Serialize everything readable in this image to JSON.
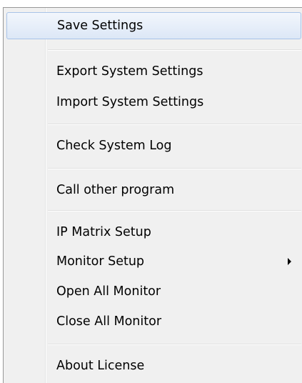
{
  "menu": {
    "items": [
      {
        "label": "Save Settings",
        "highlighted": true
      },
      {
        "label": "Export System Settings"
      },
      {
        "label": "Import System Settings"
      },
      {
        "label": "Check System Log"
      },
      {
        "label": "Call other program"
      },
      {
        "label": "IP Matrix Setup"
      },
      {
        "label": "Monitor Setup",
        "submenu_icon": "submenu-arrow-icon"
      },
      {
        "label": "Open All Monitor"
      },
      {
        "label": "Close All Monitor"
      },
      {
        "label": "About License"
      }
    ],
    "colors": {
      "background": "#f0f0f0",
      "highlight_border": "#a8c3e8",
      "highlight_fill": "#dce7f6",
      "text": "#000000"
    }
  }
}
